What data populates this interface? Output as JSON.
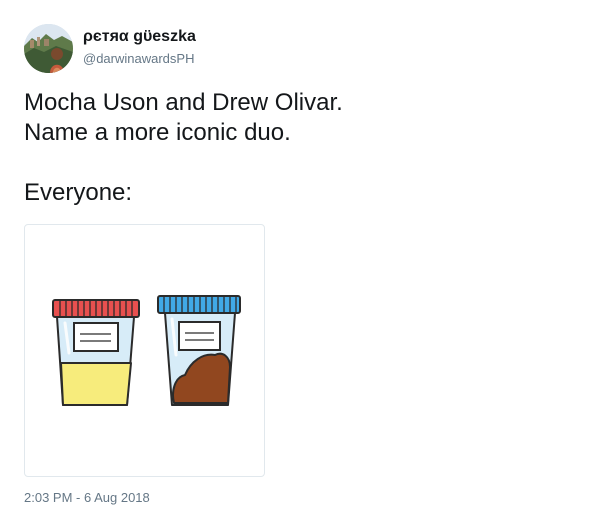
{
  "tweet": {
    "author": {
      "display_name": "ρєтяα gϋeszka",
      "handle": "@darwinawardsPH",
      "avatar_icon": "profile-photo"
    },
    "text_lines": [
      "Mocha Uson and Drew Olivar.",
      "Name a more iconic duo."
    ],
    "text_after_break": "Everyone:",
    "media": {
      "icon": "specimen-cups-illustration",
      "colors": {
        "left_lid": "#e8504f",
        "right_lid": "#41a9e6",
        "jar_glass": "#d7ecf8",
        "urine": "#f7ec7c",
        "stool": "#91471f"
      }
    },
    "timestamp": "2:03 PM - 6 Aug 2018"
  }
}
